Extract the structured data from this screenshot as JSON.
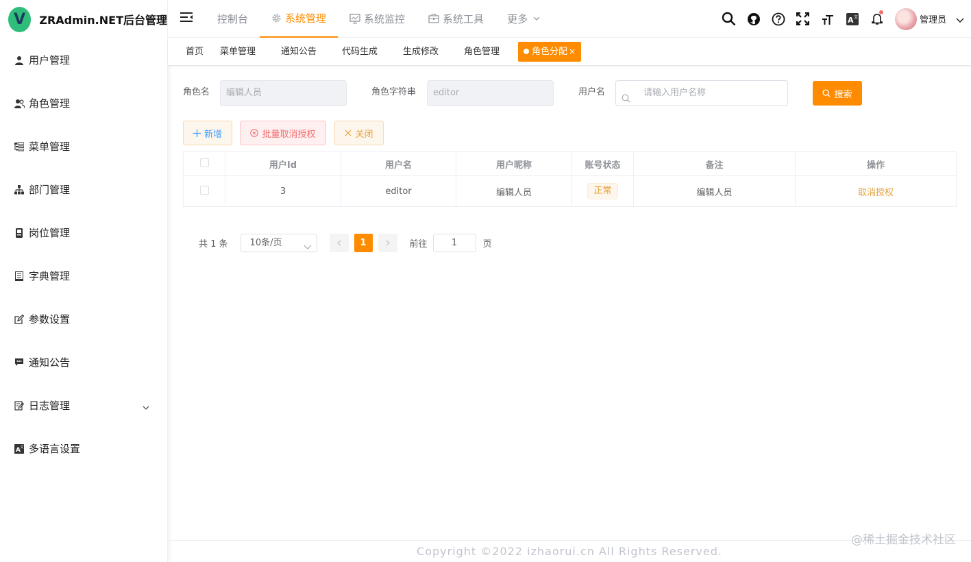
{
  "app": {
    "title": "ZRAdmin.NET后台管理",
    "logo_letter": "V",
    "brand_color": "#ff8c00"
  },
  "sidebar": {
    "items": [
      {
        "label": "用户管理",
        "icon": "user-icon"
      },
      {
        "label": "角色管理",
        "icon": "peoples-icon"
      },
      {
        "label": "菜单管理",
        "icon": "tree-table-icon"
      },
      {
        "label": "部门管理",
        "icon": "tree-icon"
      },
      {
        "label": "岗位管理",
        "icon": "post-icon"
      },
      {
        "label": "字典管理",
        "icon": "dict-icon"
      },
      {
        "label": "参数设置",
        "icon": "edit-icon"
      },
      {
        "label": "通知公告",
        "icon": "message-icon"
      },
      {
        "label": "日志管理",
        "icon": "log-icon"
      },
      {
        "label": "多语言设置",
        "icon": "language-icon"
      }
    ]
  },
  "header": {
    "nav": [
      {
        "label": "控制台"
      },
      {
        "label": "系统管理",
        "icon": "gear-icon"
      },
      {
        "label": "系统监控",
        "icon": "monitor-icon"
      },
      {
        "label": "系统工具",
        "icon": "toolbox-icon"
      },
      {
        "label": "更多"
      }
    ],
    "user_name": "管理员"
  },
  "tags": [
    {
      "label": "首页"
    },
    {
      "label": "菜单管理"
    },
    {
      "label": "通知公告"
    },
    {
      "label": "代码生成"
    },
    {
      "label": "生成修改"
    },
    {
      "label": "角色管理"
    },
    {
      "label": "角色分配",
      "close": "×"
    }
  ],
  "form": {
    "role_name_label": "角色名",
    "role_name_value": "编辑人员",
    "role_key_label": "角色字符串",
    "role_key_value": "editor",
    "username_label": "用户名",
    "username_placeholder": "请输入用户名称",
    "search_button": "搜索"
  },
  "toolbar": {
    "add": "新增",
    "batch_revoke": "批量取消授权",
    "close": "关闭"
  },
  "table": {
    "headers": [
      "用户Id",
      "用户名",
      "用户昵称",
      "账号状态",
      "备注",
      "操作"
    ],
    "rows": [
      {
        "id": "3",
        "username": "editor",
        "nickname": "编辑人员",
        "status": "正常",
        "remark": "编辑人员",
        "action": "取消授权"
      }
    ]
  },
  "pagination": {
    "total_text": "共 1 条",
    "page_size": "10条/页",
    "current_page": "1",
    "goto_label": "前往",
    "goto_value": "1",
    "page_suffix": "页"
  },
  "footer": {
    "copyright": "Copyright ©2022 izhaorui.cn All Rights Reserved."
  },
  "watermark": "@稀土掘金技术社区"
}
